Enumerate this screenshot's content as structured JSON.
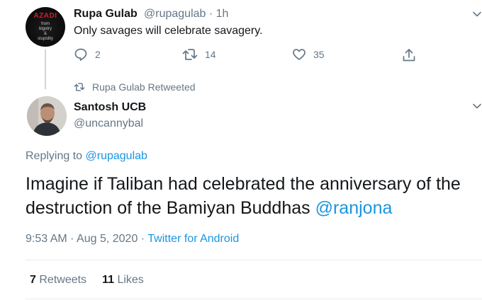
{
  "retweeted_tweet": {
    "avatar_text": [
      "AZADI",
      "from",
      "bigotry",
      "&",
      "stupidity"
    ],
    "name": "Rupa Gulab",
    "handle": "@rupagulab",
    "separator": "·",
    "time": "1h",
    "text": "Only savages will celebrate savagery.",
    "reply_count": "2",
    "retweet_count": "14",
    "like_count": "35"
  },
  "retweet_label": "Rupa Gulab Retweeted",
  "main_tweet": {
    "name": "Santosh UCB",
    "handle": "@uncannybal",
    "replying_to_prefix": "Replying to",
    "replying_to_handle": "@rupagulab",
    "text": "Imagine if Taliban had celebrated the anniversary of the destruction of the Bamiyan Buddhas",
    "mention": "@ranjona",
    "time": "9:53 AM",
    "date": "Aug 5, 2020",
    "separator": "·",
    "source": "Twitter for Android",
    "retweets_count": "7",
    "retweets_label": "Retweets",
    "likes_count": "11",
    "likes_label": "Likes"
  },
  "colors": {
    "text": "#14171a",
    "muted": "#657786",
    "link": "#1b95e0",
    "divider": "#e6ecf0"
  }
}
